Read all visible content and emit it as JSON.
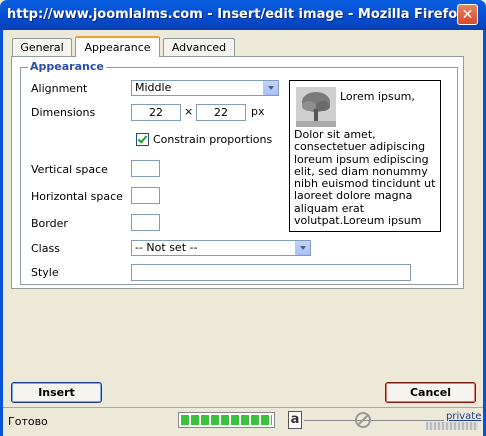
{
  "window": {
    "title": "http://www.joomlalms.com - Insert/edit image - Mozilla Firefox",
    "close_glyph": "✕"
  },
  "tabs": [
    {
      "label": "General"
    },
    {
      "label": "Appearance",
      "active": true
    },
    {
      "label": "Advanced"
    }
  ],
  "appearance": {
    "legend": "Appearance",
    "alignment_label": "Alignment",
    "alignment_value": "Middle",
    "dimensions_label": "Dimensions",
    "width_value": "22",
    "times": "×",
    "height_value": "22",
    "unit": "px",
    "constrain_label": "Constrain proportions",
    "vspace_label": "Vertical space",
    "hspace_label": "Horizontal space",
    "border_label": "Border",
    "class_label": "Class",
    "class_value": "-- Not set --",
    "style_label": "Style"
  },
  "preview": {
    "text_first": "Lorem ipsum,",
    "text_body": "Dolor sit amet, consectetuer adipiscing loreum ipsum edipiscing elit, sed diam nonummy nibh euismod tincidunt ut laoreet dolore magna aliquam erat volutpat.Loreum ipsum"
  },
  "buttons": {
    "insert": "Insert",
    "cancel": "Cancel"
  },
  "statusbar": {
    "status_text": "Готово",
    "private_label": "private",
    "progress": 1.0
  },
  "colors": {
    "titlebar": "#0752d6",
    "legend": "#2b4ca8",
    "cancel_border": "#c0392b"
  }
}
